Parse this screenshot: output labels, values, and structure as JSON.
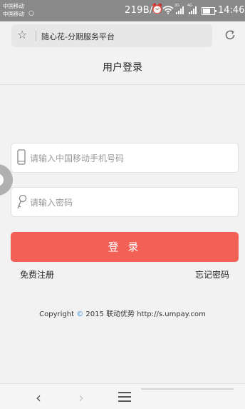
{
  "status_bar": {
    "carrier_top": "中国移动",
    "carrier_bottom": "中国移动",
    "net_rate": "219B/s",
    "sim1_type": "2G",
    "sim2_type": "4G",
    "time": "14:46"
  },
  "browser": {
    "page_title": "随心花-分期服务平台"
  },
  "page": {
    "title": "用户登录",
    "phone_placeholder": "请输入中国移动手机号码",
    "password_placeholder": "请输入密码",
    "login_label": "登 录",
    "register_link": "免费注册",
    "forgot_link": "忘记密码",
    "copyright_pre": "Copyright",
    "copyright_post": "2015 联动优势 http://s.umpay.com"
  },
  "colors": {
    "accent": "#f26056",
    "status_bar": "#8a8a8a",
    "copyright_icon": "#3a8fd6"
  },
  "icons": [
    "star-icon",
    "reload-icon",
    "phone-icon",
    "key-icon",
    "back-icon",
    "forward-icon",
    "menu-icon",
    "alarm-icon",
    "wifi-icon",
    "battery-icon"
  ]
}
